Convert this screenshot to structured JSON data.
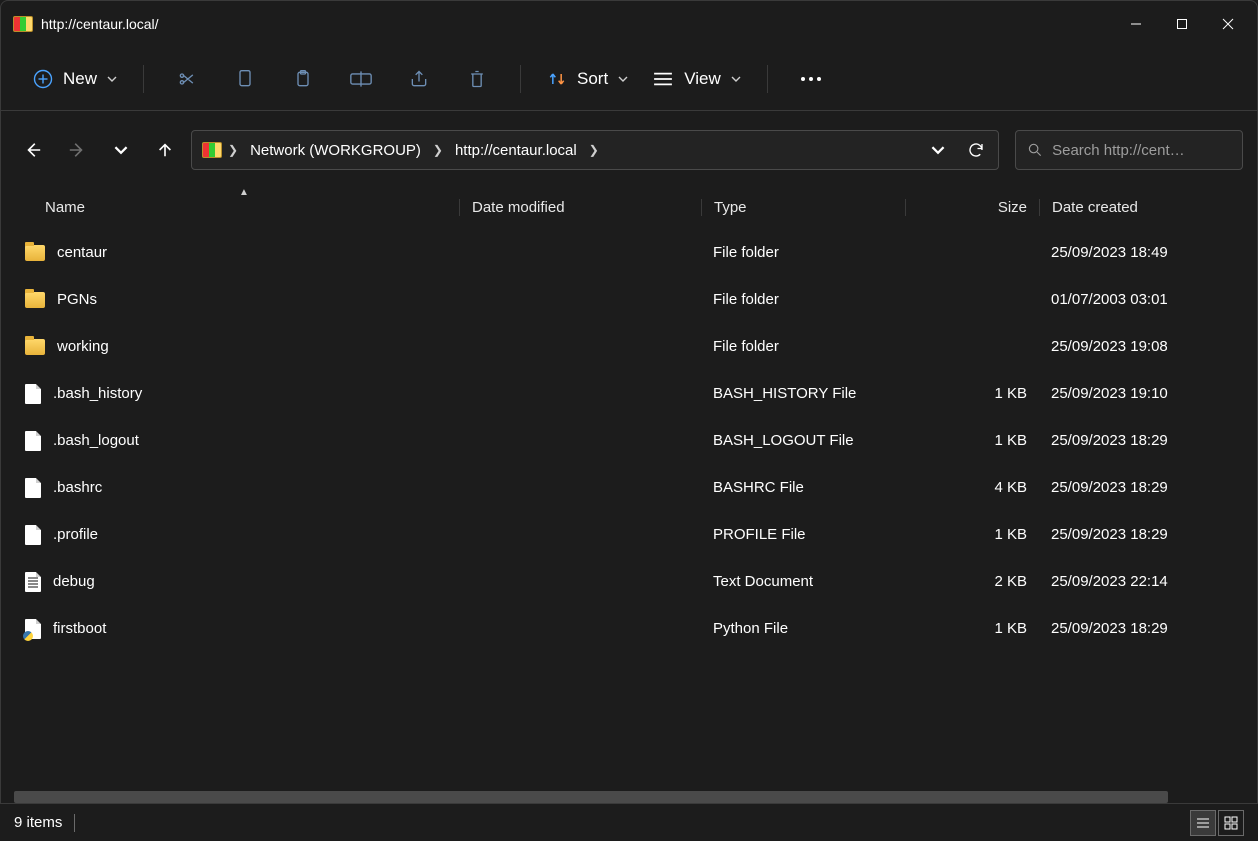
{
  "window": {
    "title": "http://centaur.local/"
  },
  "toolbar": {
    "new_label": "New",
    "sort_label": "Sort",
    "view_label": "View"
  },
  "breadcrumb": {
    "items": [
      "Network (WORKGROUP)",
      "http://centaur.local"
    ]
  },
  "search": {
    "placeholder": "Search http://cent…"
  },
  "columns": {
    "name": "Name",
    "date_modified": "Date modified",
    "type": "Type",
    "size": "Size",
    "date_created": "Date created"
  },
  "files": [
    {
      "icon": "folder",
      "name": "centaur",
      "type": "File folder",
      "size": "",
      "created": "25/09/2023 18:49"
    },
    {
      "icon": "folder",
      "name": "PGNs",
      "type": "File folder",
      "size": "",
      "created": "01/07/2003 03:01"
    },
    {
      "icon": "folder",
      "name": "working",
      "type": "File folder",
      "size": "",
      "created": "25/09/2023 19:08"
    },
    {
      "icon": "file",
      "name": ".bash_history",
      "type": "BASH_HISTORY File",
      "size": "1 KB",
      "created": "25/09/2023 19:10"
    },
    {
      "icon": "file",
      "name": ".bash_logout",
      "type": "BASH_LOGOUT File",
      "size": "1 KB",
      "created": "25/09/2023 18:29"
    },
    {
      "icon": "file",
      "name": ".bashrc",
      "type": "BASHRC File",
      "size": "4 KB",
      "created": "25/09/2023 18:29"
    },
    {
      "icon": "file",
      "name": ".profile",
      "type": "PROFILE File",
      "size": "1 KB",
      "created": "25/09/2023 18:29"
    },
    {
      "icon": "text",
      "name": "debug",
      "type": "Text Document",
      "size": "2 KB",
      "created": "25/09/2023 22:14"
    },
    {
      "icon": "py",
      "name": "firstboot",
      "type": "Python File",
      "size": "1 KB",
      "created": "25/09/2023 18:29"
    }
  ],
  "status": {
    "item_count": "9 items"
  }
}
